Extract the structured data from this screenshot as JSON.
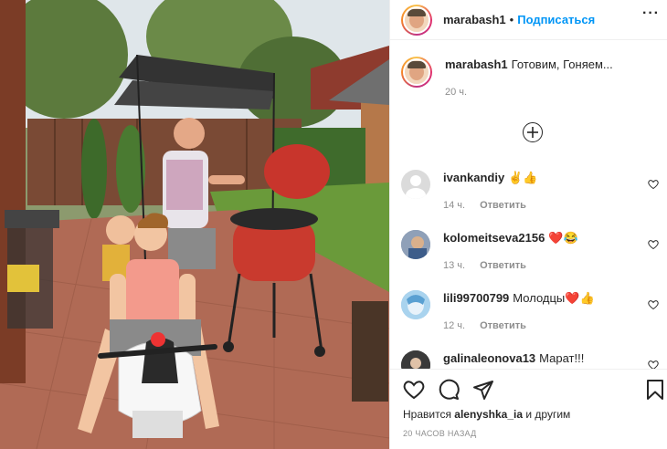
{
  "header": {
    "username": "marabash1",
    "separator": "•",
    "follow_label": "Подписаться",
    "more_label": "···"
  },
  "caption": {
    "username": "marabash1",
    "text": "Готовим, Гоняем...",
    "time": "20 ч."
  },
  "load_more_icon": "plus-circle-icon",
  "comments": [
    {
      "username": "ivankandiy",
      "text": "✌️👍",
      "time": "14 ч.",
      "reply_label": "Ответить",
      "avatar_color": "#dbdbdb"
    },
    {
      "username": "kolomeitseva2156",
      "text": "❤️😂",
      "time": "13 ч.",
      "reply_label": "Ответить",
      "avatar_color": "#7a8aa8"
    },
    {
      "username": "lili99700799",
      "text": "Молодцы❤️👍",
      "time": "12 ч.",
      "reply_label": "Ответить",
      "avatar_color": "#9fc8e6"
    },
    {
      "username": "galinaleonova13",
      "text": "Марат!!!",
      "time": "",
      "reply_label": "",
      "avatar_color": "#2a2a2a"
    }
  ],
  "actions": {
    "icons": [
      "heart-icon",
      "comment-icon",
      "share-icon",
      "bookmark-icon"
    ]
  },
  "likes": {
    "prefix": "Нравится",
    "user": "alenyshka_ia",
    "suffix": "и другим"
  },
  "post_time": "20 ЧАСОВ НАЗАД",
  "colors": {
    "accent": "#0095f6",
    "text": "#262626",
    "muted": "#8e8e8e",
    "border": "#efefef",
    "heart_red": "#ed4956"
  }
}
